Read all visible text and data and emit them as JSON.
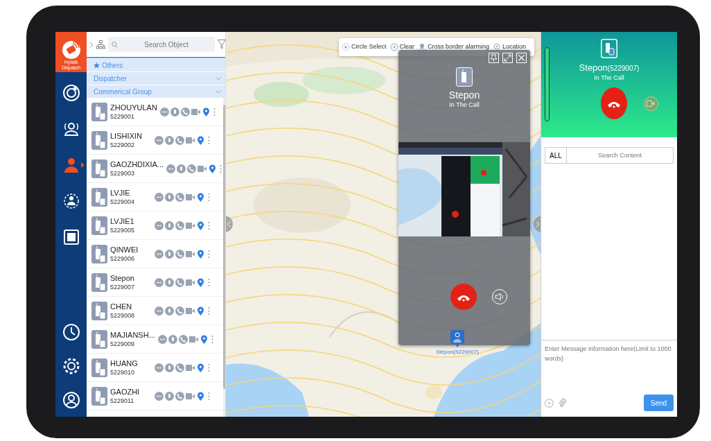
{
  "app": {
    "logo_lines": [
      "Hytalk",
      "Dispatch"
    ]
  },
  "nav_items": [
    {
      "selected": false
    },
    {
      "selected": false
    },
    {
      "selected": true
    },
    {
      "selected": false
    },
    {
      "selected": false
    }
  ],
  "nav_bottom": [
    {
      "selected": false
    },
    {
      "selected": false
    },
    {
      "selected": false
    }
  ],
  "search": {
    "placeholder": "Search Object"
  },
  "groups": [
    {
      "label": "Others",
      "kind": "starred"
    },
    {
      "label": "Dispatcher",
      "kind": "folder"
    },
    {
      "label": "Commerical Group",
      "kind": "folder"
    }
  ],
  "contacts": [
    {
      "name": "ZHOUYULAN",
      "number": "5229001"
    },
    {
      "name": "LISHIXIN",
      "number": "5229002"
    },
    {
      "name": "GAOZHDIXIA...",
      "number": "5229003"
    },
    {
      "name": "LVJIE",
      "number": "5229004"
    },
    {
      "name": "LVJIE1",
      "number": "5229005"
    },
    {
      "name": "QINWEI",
      "number": "5229006"
    },
    {
      "name": "Stepon",
      "number": "5229007"
    },
    {
      "name": "CHEN",
      "number": "5229008"
    },
    {
      "name": "MAJIANSH...",
      "number": "5229009"
    },
    {
      "name": "HUANG",
      "number": "5229010"
    },
    {
      "name": "GAOZHI",
      "number": "5229011"
    }
  ],
  "map_toolbar": [
    "Circle Select",
    "Clear",
    "Cross border alarming",
    "Location"
  ],
  "call_popup": {
    "name": "Stepon",
    "status": "In The Call"
  },
  "map_marker": {
    "label": "Stepon(5229007)"
  },
  "call_panel": {
    "name": "Stepon",
    "number": "(5229007)",
    "status": "In The Call"
  },
  "chat": {
    "filter": "ALL",
    "search_placeholder": "Search Content",
    "message_placeholder": "Enter Message information here(Limit to 1000 words)",
    "send": "Send"
  }
}
